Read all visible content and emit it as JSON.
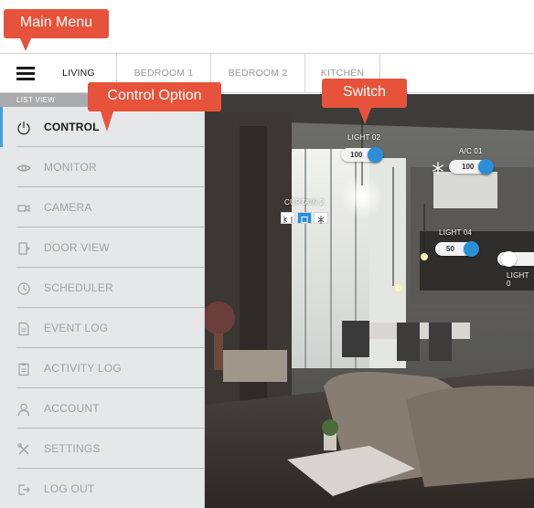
{
  "annotations": {
    "main_menu": "Main Menu",
    "control_option": "Control Option",
    "switch": "Switch"
  },
  "header": {
    "menu_icon": "hamburger-icon",
    "tabs": [
      {
        "label": "LIVING",
        "active": true
      },
      {
        "label": "BEDROOM 1",
        "active": false
      },
      {
        "label": "BEDROOM 2",
        "active": false
      },
      {
        "label": "KITCHEN",
        "active": false
      }
    ]
  },
  "sidebar": {
    "section_label": "LIST VIEW",
    "items": [
      {
        "label": "CONTROL",
        "icon": "power-icon",
        "active": true
      },
      {
        "label": "MONITOR",
        "icon": "eye-icon",
        "active": false
      },
      {
        "label": "CAMERA",
        "icon": "camera-icon",
        "active": false
      },
      {
        "label": "DOOR VIEW",
        "icon": "door-icon",
        "active": false
      },
      {
        "label": "SCHEDULER",
        "icon": "clock-icon",
        "active": false
      },
      {
        "label": "EVENT LOG",
        "icon": "document-icon",
        "active": false
      },
      {
        "label": "ACTIVITY LOG",
        "icon": "clipboard-icon",
        "active": false
      },
      {
        "label": "ACCOUNT",
        "icon": "user-icon",
        "active": false
      },
      {
        "label": "SETTINGS",
        "icon": "tools-icon",
        "active": false
      },
      {
        "label": "LOG OUT",
        "icon": "logout-icon",
        "active": false
      }
    ]
  },
  "devices": {
    "light02": {
      "label": "LIGHT 02",
      "value": "100"
    },
    "ac01": {
      "label": "A/C 01",
      "value": "100",
      "icon": "snowflake-icon"
    },
    "curtain2": {
      "label": "CURTAIN 2",
      "buttons": [
        "open-icon",
        "stop-icon",
        "close-icon"
      ],
      "selected": "stop-icon"
    },
    "light04": {
      "label": "LIGHT 04",
      "value": "50"
    },
    "light0x": {
      "label": "LIGHT 0"
    }
  },
  "colors": {
    "accent": "#2b8fd8",
    "active_bar": "#3aa0e0",
    "callout": "#e6533a",
    "sidebar_bg": "#e6e7e9"
  }
}
